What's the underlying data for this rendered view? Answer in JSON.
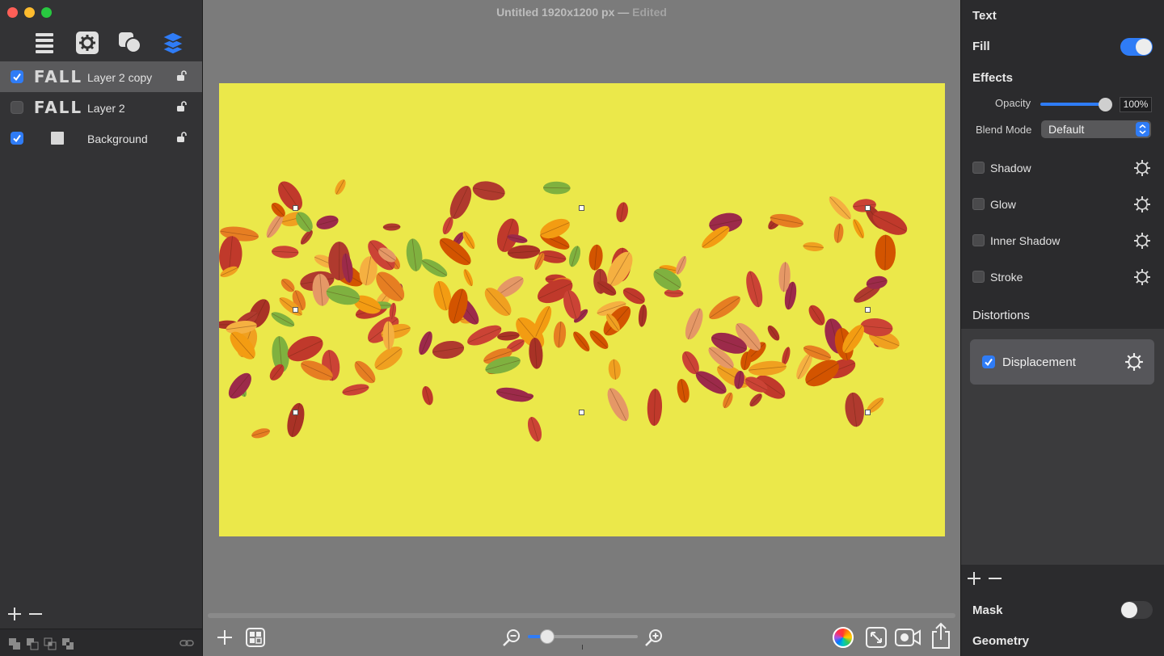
{
  "window": {
    "title": "Untitled 1920x1200 px",
    "title_sep": "—",
    "status": "Edited"
  },
  "sidebar": {
    "tools": [
      "list-icon",
      "gear-icon",
      "shapes-icon",
      "layers-icon"
    ],
    "layers": [
      {
        "thumb": "FALL",
        "name": "Layer 2 copy",
        "visible": true,
        "selected": true
      },
      {
        "thumb": "FALL",
        "name": "Layer 2",
        "visible": false,
        "selected": false
      },
      {
        "thumb": "",
        "name": "Background",
        "visible": true,
        "selected": false
      }
    ]
  },
  "canvas": {
    "background": "#ebe84a"
  },
  "zoom": {
    "level": 0.18
  },
  "inspector": {
    "text_header": "Text",
    "fill_label": "Fill",
    "fill_on": true,
    "effects_header": "Effects",
    "opacity_label": "Opacity",
    "opacity_value": "100%",
    "blend_label": "Blend Mode",
    "blend_value": "Default",
    "effects": [
      {
        "label": "Shadow",
        "checked": false
      },
      {
        "label": "Glow",
        "checked": false
      },
      {
        "label": "Inner Shadow",
        "checked": false
      },
      {
        "label": "Stroke",
        "checked": false
      }
    ],
    "distortions_header": "Distortions",
    "distortion": {
      "label": "Displacement",
      "checked": true
    },
    "mask_label": "Mask",
    "mask_on": false,
    "geometry_header": "Geometry"
  },
  "colors": {
    "accent": "#2f7cf6",
    "canvas_yellow": "#ebe84a"
  }
}
